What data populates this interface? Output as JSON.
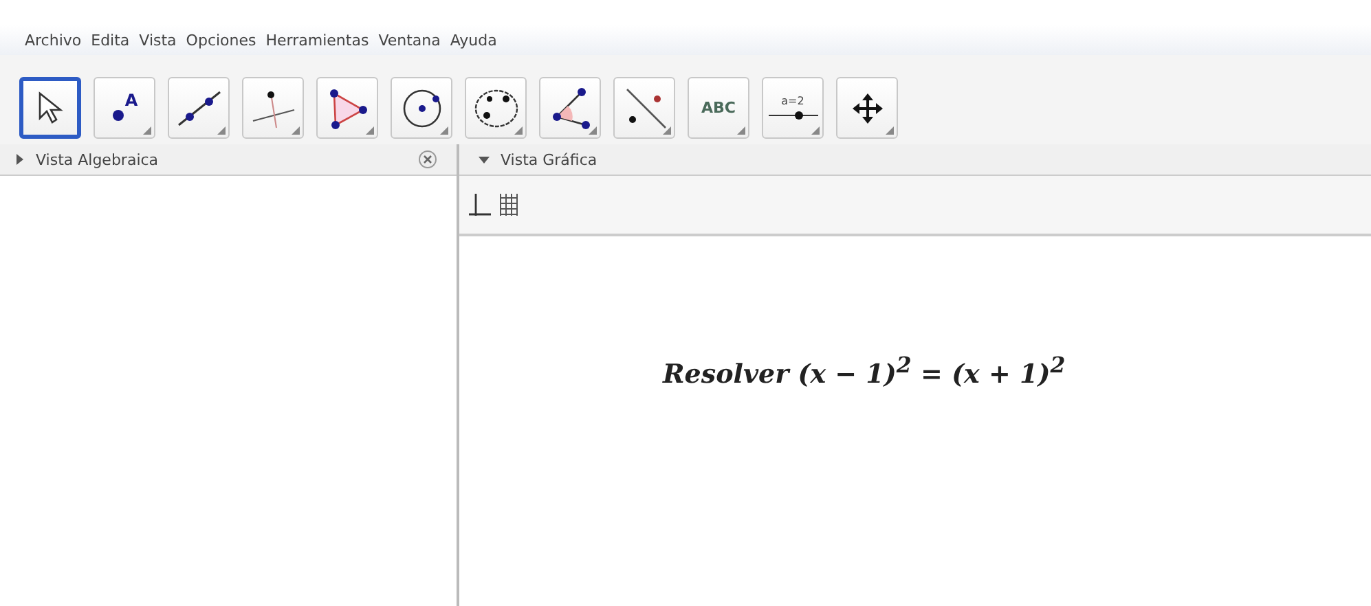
{
  "menu": [
    "Archivo",
    "Edita",
    "Vista",
    "Opciones",
    "Herramientas",
    "Ventana",
    "Ayuda"
  ],
  "tools": [
    {
      "kind": "move",
      "selected": true
    },
    {
      "kind": "point",
      "label": "A",
      "selected": false
    },
    {
      "kind": "line",
      "selected": false
    },
    {
      "kind": "perpendicular",
      "selected": false
    },
    {
      "kind": "polygon",
      "selected": false
    },
    {
      "kind": "circle",
      "selected": false
    },
    {
      "kind": "conic",
      "selected": false
    },
    {
      "kind": "angle",
      "selected": false
    },
    {
      "kind": "reflect",
      "selected": false
    },
    {
      "kind": "text",
      "label": "ABC",
      "selected": false
    },
    {
      "kind": "slider",
      "label": "a=2",
      "selected": false
    },
    {
      "kind": "pan",
      "selected": false
    }
  ],
  "algebra_view": {
    "title": "Vista Algebraica",
    "expanded": false
  },
  "graphics_view": {
    "title": "Vista Gráfica",
    "expanded": true,
    "text": "Resolver (x − 1)$^{2}$ = (x + 1)$^{2}$"
  }
}
